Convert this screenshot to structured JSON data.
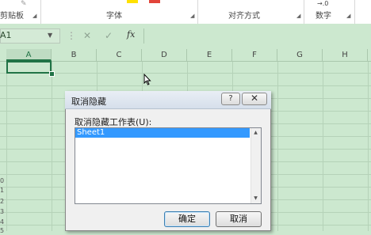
{
  "ribbon": {
    "groups": {
      "clipboard": "剪贴板",
      "font": "字体",
      "alignment": "对齐方式",
      "number": "数字"
    },
    "number_format_hint": "→.0"
  },
  "formula_bar": {
    "name_box": "A1",
    "cancel_symbol": "✕",
    "enter_symbol": "✓",
    "fx_symbol": "fx"
  },
  "sheet": {
    "columns": [
      "A",
      "B",
      "C",
      "D",
      "E",
      "F",
      "G",
      "H"
    ],
    "active_column": "A",
    "row_fragments": [
      "0",
      "1",
      "2",
      "3",
      "4",
      "5"
    ]
  },
  "dialog": {
    "title": "取消隐藏",
    "help_label": "?",
    "close_label": "✕",
    "list_label": "取消隐藏工作表(U):",
    "items": [
      "Sheet1"
    ],
    "selected_item": "Sheet1",
    "ok_label": "确定",
    "cancel_label": "取消"
  },
  "colors": {
    "sheet_bg": "#cce8cf",
    "accent": "#217346",
    "selection": "#3399ff",
    "yellow_chip": "#ffe100",
    "red_chip": "#e2443a"
  }
}
